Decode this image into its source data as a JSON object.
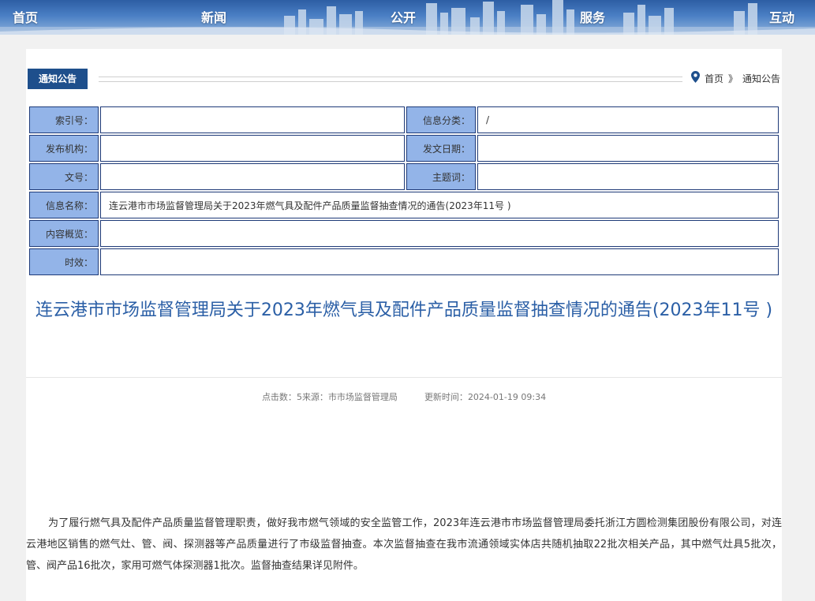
{
  "nav": {
    "items": [
      "首页",
      "新闻",
      "公开",
      "服务",
      "互动"
    ]
  },
  "section": {
    "tab_label": "通知公告"
  },
  "breadcrumb": {
    "home": "首页",
    "separator": "》",
    "current": "通知公告"
  },
  "meta": {
    "rows": [
      [
        {
          "label": "索引号：",
          "value": ""
        },
        {
          "label": "信息分类：",
          "value": "/"
        }
      ],
      [
        {
          "label": "发布机构：",
          "value": ""
        },
        {
          "label": "发文日期：",
          "value": ""
        }
      ],
      [
        {
          "label": "文号：",
          "value": ""
        },
        {
          "label": "主题词：",
          "value": ""
        }
      ]
    ],
    "full_rows": [
      {
        "label": "信息名称：",
        "value": "连云港市市场监督管理局关于2023年燃气具及配件产品质量监督抽查情况的通告(2023年11号 )"
      },
      {
        "label": "内容概览：",
        "value": ""
      },
      {
        "label": "时效：",
        "value": ""
      }
    ]
  },
  "article": {
    "title": "连云港市市场监督管理局关于2023年燃气具及配件产品质量监督抽查情况的通告(2023年11号 )",
    "clicks_label": "点击数：",
    "clicks_value": "5",
    "source_label": "来源：",
    "source_value": "市市场监督管理局",
    "updated_label": "更新时间：",
    "updated_value": "2024-01-19 09:34",
    "body": "为了履行燃气具及配件产品质量监督管理职责，做好我市燃气领域的安全监管工作，2023年连云港市市场监督管理局委托浙江方圆检测集团股份有限公司，对连云港地区销售的燃气灶、管、阀、探测器等产品质量进行了市级监督抽查。本次监督抽查在我市流通领域实体店共随机抽取22批次相关产品，其中燃气灶具5批次，管、阀产品16批次，家用可燃气体探测器1批次。监督抽查结果详见附件。"
  },
  "colors": {
    "nav_top": "#2d5ea4",
    "tab_bg": "#1e4f8c",
    "label_bg": "#93b4e8",
    "cell_border": "#1e3a78",
    "title_color": "#2b5fa6",
    "pin_color": "#1e4f8c"
  },
  "icons": {
    "breadcrumb_icon": "location-pin-icon"
  }
}
